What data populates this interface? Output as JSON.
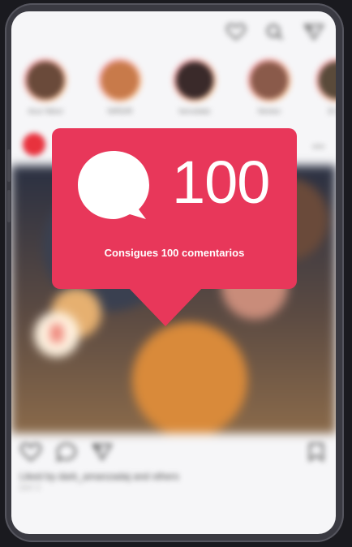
{
  "notification": {
    "count": "100",
    "caption": "Consigues 100 comentarios",
    "icon": "comment-bubble-icon",
    "color": "#e8375a"
  },
  "stories": [
    {
      "username": "Azur Nilovi",
      "color": "#6a4a3a"
    },
    {
      "username": "NIRDIR",
      "color": "#c87a4a"
    },
    {
      "username": "hervoliato",
      "color": "#3a2a2a"
    },
    {
      "username": "Nimlon",
      "color": "#8a5a4a"
    },
    {
      "username": "El Lin",
      "color": "#5a4a3a"
    }
  ],
  "post": {
    "likes_text": "Liked by dark_amanzadaj and others",
    "time_text": "DAY 3"
  },
  "top_icons": [
    "heart-icon",
    "search-icon",
    "send-icon"
  ],
  "action_icons": [
    "like-icon",
    "comment-icon",
    "share-icon",
    "save-icon"
  ],
  "nav_icons": [
    "home-icon",
    "reels-icon",
    "video-icon",
    "shop-icon",
    "profile-icon"
  ]
}
